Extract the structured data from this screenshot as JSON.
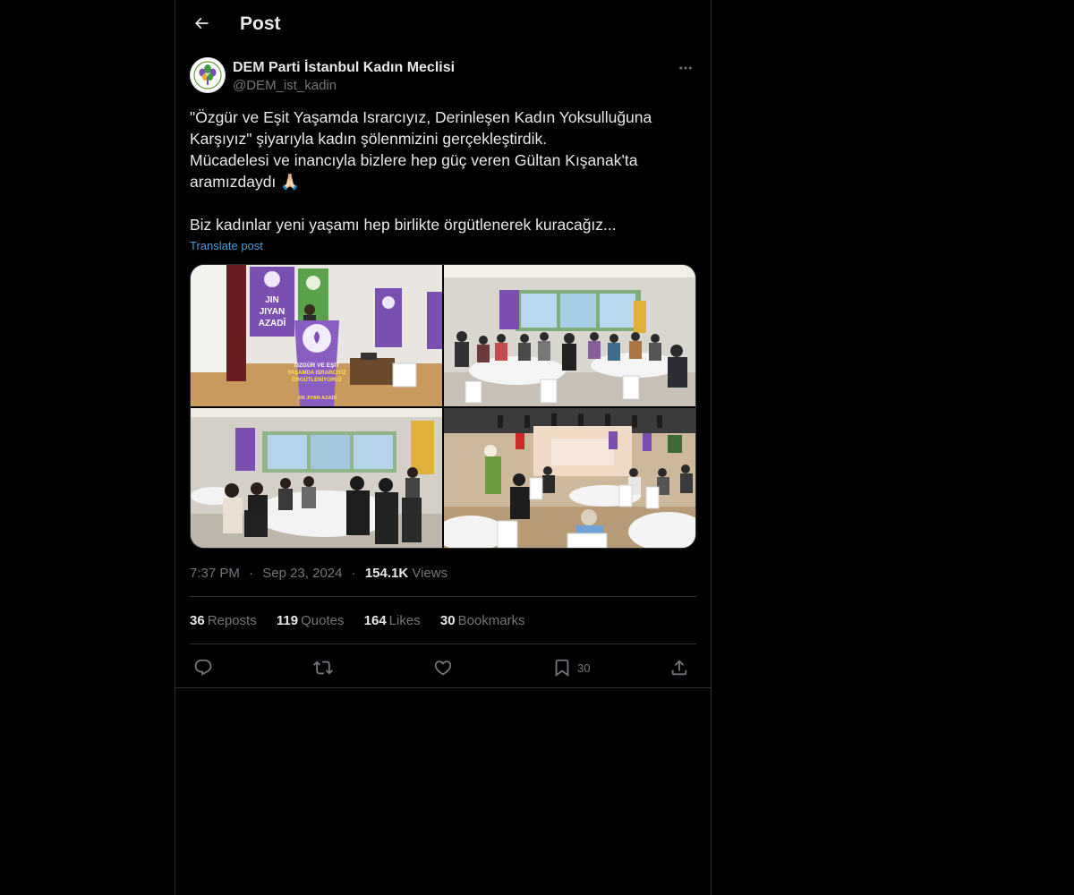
{
  "header": {
    "title": "Post",
    "back_icon": "arrow-left-icon"
  },
  "author": {
    "name": "DEM Parti İstanbul Kadın Meclisi",
    "handle": "@DEM_ist_kadin",
    "more_icon": "more-horizontal-icon"
  },
  "post": {
    "text": "\"Özgür ve Eşit Yaşamda Israrcıyız, Derinleşen Kadın Yoksulluğuna Karşıyız\" şiyarıyla kadın şölenmizini gerçekleştirdik.\nMücadelesi ve inancıyla bizlere hep güç veren Gültan Kışanak'ta aramızdaydı 🙏🏻\n\nBiz kadınlar yeni yaşamı hep birlikte örgütlenerek kuracağız...",
    "translate_label": "Translate post",
    "photo_signs": {
      "left_banner": [
        "JIN",
        "JIYAN",
        "AZADÎ"
      ],
      "podium": [
        "ÖZGÜR VE EŞİT",
        "YAŞAMDA ISRARCIYIZ",
        "ÖRGÜTLENİYORUZ"
      ],
      "podium_bottom": [
        "JIN JIYAN AZADÎ"
      ]
    }
  },
  "meta": {
    "time": "7:37 PM",
    "date": "Sep 23, 2024",
    "separator": "·",
    "views_count": "154.1K",
    "views_label": "Views"
  },
  "stats": {
    "reposts": {
      "count": "36",
      "label": "Reposts"
    },
    "quotes": {
      "count": "119",
      "label": "Quotes"
    },
    "likes": {
      "count": "164",
      "label": "Likes"
    },
    "bookmarks": {
      "count": "30",
      "label": "Bookmarks"
    }
  },
  "actions": {
    "reply_icon": "reply-icon",
    "repost_icon": "repost-icon",
    "like_icon": "like-icon",
    "bookmark_icon": "bookmark-icon",
    "bookmark_count": "30",
    "share_icon": "share-icon"
  },
  "colors": {
    "background": "#000000",
    "text_primary": "#e7e9ea",
    "text_secondary": "#71767b",
    "link": "#4d9bd5",
    "border": "#2f3336",
    "brand_purple": "#7a4fb1",
    "brand_green": "#3f9b3f"
  }
}
